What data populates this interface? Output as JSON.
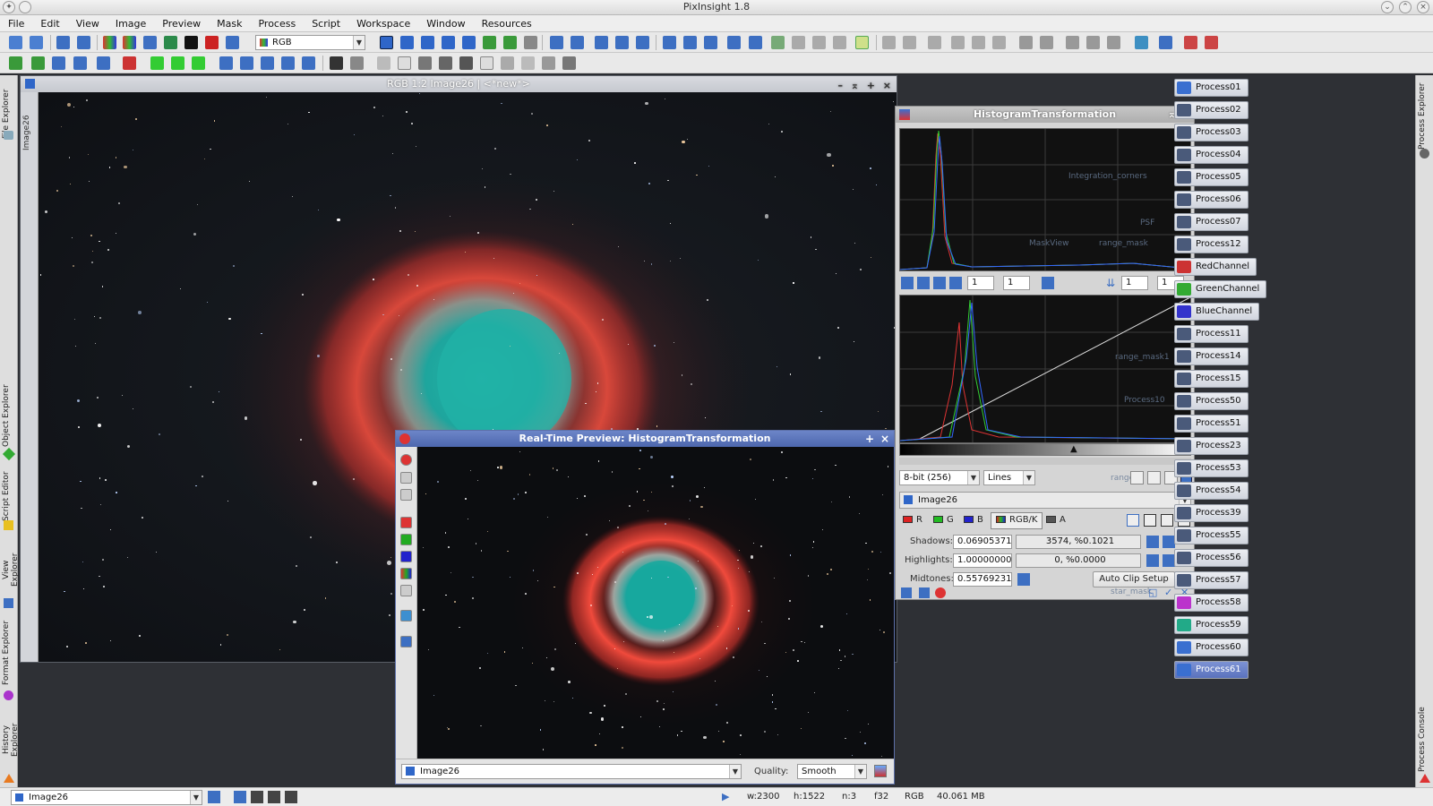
{
  "window": {
    "title": "PixInsight 1.8"
  },
  "menu": [
    "File",
    "Edit",
    "View",
    "Image",
    "Preview",
    "Mask",
    "Process",
    "Script",
    "Workspace",
    "Window",
    "Resources"
  ],
  "toolbar": {
    "color_space": "RGB"
  },
  "left_tabs": [
    "File Explorer",
    "Object Explorer",
    "Script Editor",
    "View Explorer",
    "Format Explorer",
    "History Explorer"
  ],
  "right_tabs": [
    "Process Explorer",
    "Process Console"
  ],
  "image_window": {
    "title": "RGB 1:2 Image26 | <*new*>",
    "vtab": "Image26"
  },
  "preview": {
    "title": "Real-Time Preview: HistogramTransformation",
    "view": "Image26",
    "quality_label": "Quality:",
    "quality": "Smooth"
  },
  "histogram": {
    "title": "HistogramTransformation",
    "zoom_h1": "1",
    "zoom_v1": "1",
    "zoom_h2": "1",
    "zoom_v2": "1",
    "resolution": "8-bit (256)",
    "graph_style": "Lines",
    "view": "Image26",
    "channels": {
      "r": "R",
      "g": "G",
      "b": "B",
      "rgbk": "RGB/K",
      "a": "A"
    },
    "shadows_label": "Shadows:",
    "shadows": "0.06905371",
    "shadows_clip": "3574, %0.1021",
    "highlights_label": "Highlights:",
    "highlights": "1.00000000",
    "highlights_clip": "0, %0.0000",
    "midtones_label": "Midtones:",
    "midtones": "0.55769231",
    "auto_clip": "Auto Clip Setup",
    "ghost_icons": [
      "Integration_corners",
      "PSF",
      "MaskView",
      "range_mask",
      "range_mask1",
      "Process10",
      "range",
      "star_mask"
    ]
  },
  "process_icons": [
    "Process01",
    "Process02",
    "Process03",
    "Process04",
    "Process05",
    "Process06",
    "Process07",
    "Process12",
    "RedChannel",
    "GreenChannel",
    "BlueChannel",
    "Process11",
    "Process14",
    "Process15",
    "Process50",
    "Process51",
    "Process23",
    "Process53",
    "Process54",
    "Process39",
    "Process55",
    "Process56",
    "Process57",
    "Process58",
    "Process59",
    "Process60",
    "Process61"
  ],
  "status": {
    "view": "Image26",
    "width": "w:2300",
    "height": "h:1522",
    "channels": "n:3",
    "format": "f32",
    "space": "RGB",
    "size": "40.061 MB"
  },
  "colors": {
    "accent": "#5a72bd",
    "nebula_red": "#c83a32",
    "nebula_teal": "#1fa8a0"
  }
}
